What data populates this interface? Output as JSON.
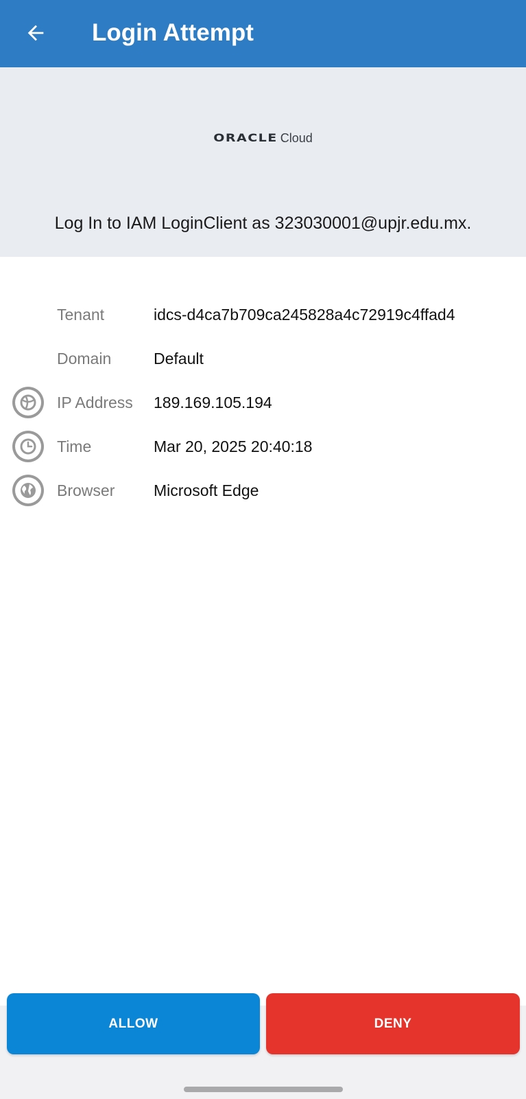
{
  "appbar": {
    "back_icon": "arrow-left-icon",
    "title": "Login Attempt"
  },
  "header": {
    "brand_oracle": "ORACLE",
    "brand_cloud": "Cloud",
    "login_text": "Log In to IAM LoginClient as 323030001@upjr.edu.mx."
  },
  "details": [
    {
      "icon": null,
      "label": "Tenant",
      "value": "idcs-d4ca7b709ca245828a4c72919c4ffad4"
    },
    {
      "icon": null,
      "label": "Domain",
      "value": "Default"
    },
    {
      "icon": "network-icon",
      "label": "IP Address",
      "value": "189.169.105.194"
    },
    {
      "icon": "clock-icon",
      "label": "Time",
      "value": "Mar 20, 2025 20:40:18"
    },
    {
      "icon": "globe-icon",
      "label": "Browser",
      "value": "Microsoft Edge"
    }
  ],
  "actions": {
    "allow_label": "ALLOW",
    "deny_label": "DENY"
  },
  "colors": {
    "appbar": "#2e7cc4",
    "allow": "#0b86d6",
    "deny": "#e5342b",
    "header_bg": "#e9ecf1"
  }
}
